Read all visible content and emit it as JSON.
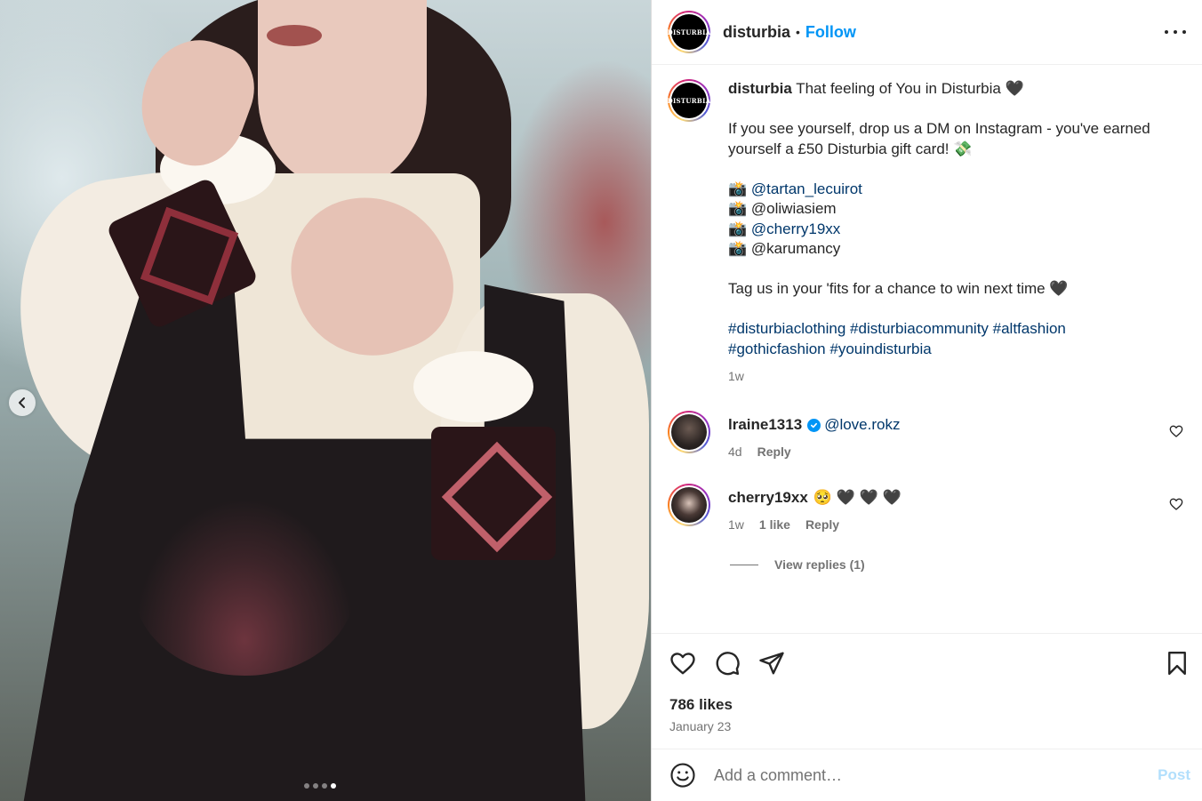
{
  "photo": {
    "carousel": {
      "total": 4,
      "active_index": 3
    }
  },
  "header": {
    "username": "disturbia",
    "separator": "•",
    "follow_label": "Follow",
    "avatar_logo_text": "DISTURBIA"
  },
  "caption": {
    "username": "disturbia",
    "line1_text": "That feeling of You in Disturbia 🖤",
    "line2_text": "If you see yourself, drop us a DM on Instagram - you've earned yourself a £50 Disturbia gift card! 💸",
    "credits": [
      {
        "emoji": "📸",
        "handle": "@tartan_lecuirot",
        "linked": true
      },
      {
        "emoji": "📸",
        "handle": "@oliwiasiem",
        "linked": false
      },
      {
        "emoji": "📸",
        "handle": "@cherry19xx",
        "linked": true
      },
      {
        "emoji": "📸",
        "handle": "@karumancy",
        "linked": false
      }
    ],
    "line3_text": "Tag us in your 'fits for a chance to win next time 🖤",
    "hashtags_line1": "#disturbiaclothing #disturbiacommunity #altfashion",
    "hashtags_line2": "#gothicfashion #youindisturbia",
    "time": "1w"
  },
  "comments": [
    {
      "username": "lraine1313",
      "verified": true,
      "text": "@love.rokz",
      "time": "4d",
      "likes": "",
      "reply_label": "Reply"
    },
    {
      "username": "cherry19xx",
      "verified": false,
      "text": "🥺 🖤 🖤 🖤",
      "time": "1w",
      "likes": "1 like",
      "reply_label": "Reply"
    }
  ],
  "view_replies_label": "View replies (1)",
  "engagement": {
    "likes": "786 likes",
    "date": "January 23"
  },
  "add_comment": {
    "placeholder": "Add a comment…",
    "post_label": "Post"
  },
  "colors": {
    "accent_blue": "#0095f6",
    "link_blue": "#00376b",
    "muted_text": "#737373",
    "post_disabled": "#b2dffc"
  },
  "icons": [
    "chevron-left-icon",
    "more-icon",
    "heart-icon",
    "comment-icon",
    "share-icon",
    "bookmark-icon",
    "emoji-icon",
    "verified-badge-icon"
  ]
}
